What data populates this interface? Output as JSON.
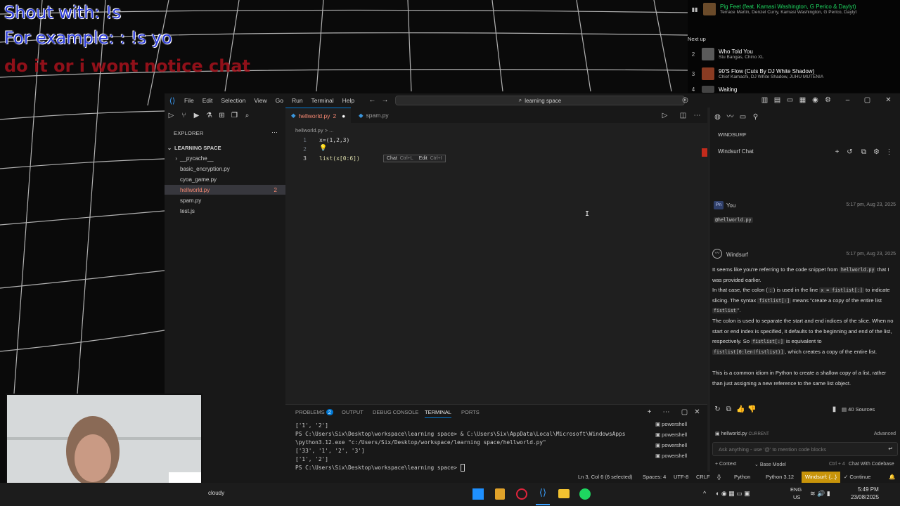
{
  "overlay": {
    "line1": "Shout with: !s",
    "line2": "For example: : !s yo",
    "line3": "do it or i wont notice chat"
  },
  "queue": {
    "current_title": "Pig Feet (feat. Kamasi Washington, G Perico & Daylyt)",
    "current_artists": "Terrace Martin, Denzel Curry, Kamasi Washington, G Perico, Daylyt",
    "next_label": "Next up",
    "items": [
      {
        "num": "2",
        "title": "Who Told You",
        "artists": "Stu Bangas, Chino XL"
      },
      {
        "num": "3",
        "title": "90'S Flow (Cuts By DJ White Shadow)",
        "artists": "Chief Kamachi, DJ White Shadow, JUHU MUTENIA"
      },
      {
        "num": "4",
        "title": "Waiting",
        "artists": ""
      }
    ]
  },
  "titlebar": {
    "menu": [
      "File",
      "Edit",
      "Selection",
      "View",
      "Go",
      "Run",
      "Terminal",
      "Help"
    ],
    "search": "learning space"
  },
  "explorer": {
    "title": "EXPLORER",
    "folder": "LEARNING SPACE",
    "files": [
      {
        "name": "__pycache__",
        "badge": ""
      },
      {
        "name": "basic_encryption.py",
        "badge": ""
      },
      {
        "name": "cyoa_game.py",
        "badge": ""
      },
      {
        "name": "hellworld.py",
        "badge": "2"
      },
      {
        "name": "spam.py",
        "badge": ""
      },
      {
        "name": "test.js",
        "badge": ""
      }
    ]
  },
  "tabs": [
    {
      "label": "hellworld.py",
      "badge": "2"
    },
    {
      "label": "spam.py",
      "badge": ""
    }
  ],
  "breadcrumb": "hellworld.py > ...",
  "editor": {
    "lines": [
      {
        "n": "1",
        "text": "x=(1,2,3)"
      },
      {
        "n": "2",
        "text": ""
      },
      {
        "n": "3",
        "text": "list(x[0:6])"
      }
    ],
    "hint_chat": "Chat",
    "hint_chat_key": "Ctrl+L",
    "hint_edit": "Edit",
    "hint_edit_key": "Ctrl+I"
  },
  "panel": {
    "tabs": [
      "PROBLEMS",
      "OUTPUT",
      "DEBUG CONSOLE",
      "TERMINAL",
      "PORTS"
    ],
    "problems_badge": "2",
    "terminal_lines": [
      "['1', '2']",
      "PS C:\\Users\\Six\\Desktop\\workspace\\learning space> & C:\\Users\\Six\\AppData\\Local\\Microsoft\\WindowsApps",
      "\\python3.12.exe \"c:/Users/Six/Desktop/workspace/learning space/hellworld.py\"",
      "['33', '1', '2', '3']",
      "['1', '2']",
      "PS C:\\Users\\Six\\Desktop\\workspace\\learning space> "
    ],
    "shells": [
      "powershell",
      "powershell",
      "powershell",
      "powershell"
    ]
  },
  "chat": {
    "header": "WINDSURF",
    "title": "Windsurf Chat",
    "user_initials": "Pn",
    "user_name": "You",
    "user_time": "5:17 pm, Aug 23, 2025",
    "user_mention": "@hellworld.py",
    "bot_name": "Windsurf",
    "bot_time": "5:17 pm, Aug 23, 2025",
    "p1a": "It seems like you're referring to the code snippet from ",
    "p1code": "hellworld.py",
    "p1b": " that I was provided earlier.",
    "p2a": "In that case, the colon (",
    "p2code1": ":",
    "p2b": ") is used in the line ",
    "p2code2": "x = fistlist[:]",
    "p2c": " to indicate slicing. The syntax ",
    "p2code3": "fistlist[:]",
    "p2d": " means \"create a copy of the entire list ",
    "p2code4": "fistlist",
    "p2e": "\".",
    "p3a": "The colon is used to separate the start and end indices of the slice. When no start or end index is specified, it defaults to the beginning and end of the list, respectively. So ",
    "p3code1": "fistlist[:]",
    "p3b": " is equivalent to ",
    "p3code2": "fistlist[0:len(fistlist)]",
    "p3c": ", which creates a copy of the entire list.",
    "p4": "This is a common idiom in Python to create a shallow copy of a list, rather than just assigning a new reference to the same list object.",
    "sources": "40 Sources",
    "context_file": "hellworld.py",
    "context_tag": "CURRENT",
    "advanced": "Advanced",
    "input_placeholder": "Ask anything - use '@' to mention code blocks",
    "footer_context": "+ Context",
    "footer_model": "Base Model",
    "footer_shortcut": "Ctrl + 4",
    "footer_mode": "Chat With Codebase"
  },
  "status": {
    "position": "Ln 3, Col 6 (6 selected)",
    "spaces": "Spaces: 4",
    "encoding": "UTF-8",
    "eol": "CRLF",
    "language": "Python",
    "interpreter": "Python 3.12",
    "windsurf": "Windsurf: {...}",
    "continue": "Continue"
  },
  "taskbar": {
    "weather": "cloudy",
    "lang": "ENG",
    "region": "US",
    "time": "5:49 PM",
    "date": "23/08/2025"
  },
  "colors": {
    "accent": "#0078d4",
    "error": "#f48771",
    "windsurf_status": "#c8940a",
    "spotify_green": "#1ed760"
  }
}
